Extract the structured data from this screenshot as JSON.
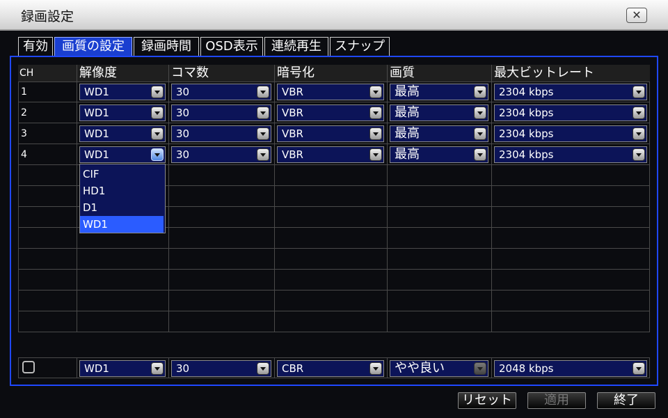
{
  "window": {
    "title": "録画設定",
    "close_label": "✕"
  },
  "tabs": [
    {
      "label": "有効"
    },
    {
      "label": "画質の設定",
      "active": true
    },
    {
      "label": "録画時間"
    },
    {
      "label": "OSD表示"
    },
    {
      "label": "連続再生"
    },
    {
      "label": "スナップ"
    }
  ],
  "table": {
    "headers": [
      "CH",
      "解像度",
      "コマ数",
      "暗号化",
      "画質",
      "最大ビットレート"
    ],
    "rows": [
      {
        "ch": "1",
        "resolution": "WD1",
        "fps": "30",
        "encoding": "VBR",
        "quality": "最高",
        "bitrate": "2304 kbps"
      },
      {
        "ch": "2",
        "resolution": "WD1",
        "fps": "30",
        "encoding": "VBR",
        "quality": "最高",
        "bitrate": "2304 kbps"
      },
      {
        "ch": "3",
        "resolution": "WD1",
        "fps": "30",
        "encoding": "VBR",
        "quality": "最高",
        "bitrate": "2304 kbps"
      },
      {
        "ch": "4",
        "resolution": "WD1",
        "fps": "30",
        "encoding": "VBR",
        "quality": "最高",
        "bitrate": "2304 kbps"
      }
    ]
  },
  "dropdown": {
    "options": [
      "CIF",
      "HD1",
      "D1",
      "WD1"
    ],
    "selected": "WD1"
  },
  "all_row": {
    "resolution": "WD1",
    "fps": "30",
    "encoding": "CBR",
    "quality": "やや良い",
    "bitrate": "2048 kbps"
  },
  "buttons": {
    "reset": "リセット",
    "apply": "適用",
    "exit": "終了"
  },
  "colors": {
    "accent": "#1f48ff",
    "select_bg": "#0c1458",
    "active_tab": "#1a3fd0"
  }
}
